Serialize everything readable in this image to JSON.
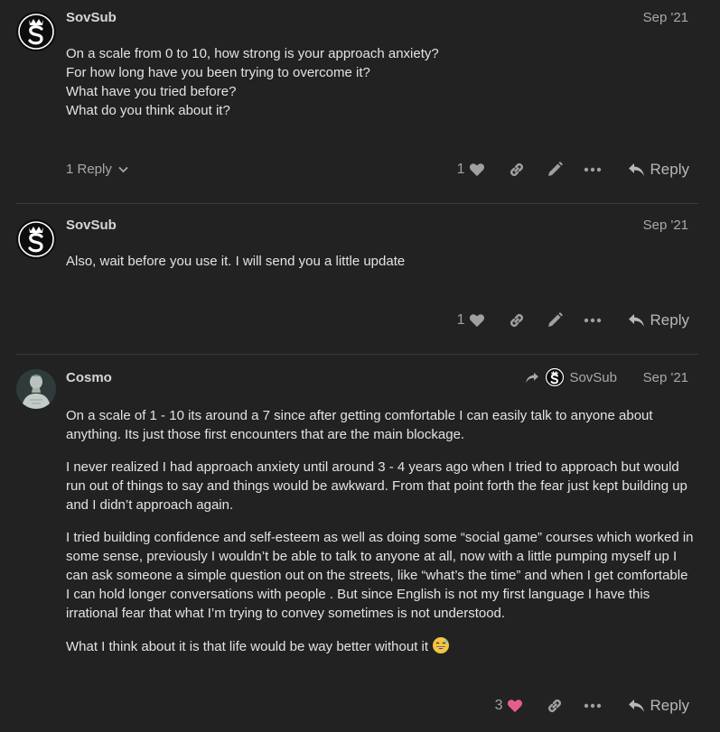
{
  "colors": {
    "background": "#222222",
    "text": "#e3e3e3",
    "muted": "#a9a9a9",
    "liked_heart": "#e45f88"
  },
  "posts": [
    {
      "username": "SovSub",
      "date": "Sep '21",
      "lines": [
        "On a scale from 0 to 10, how strong is your approach anxiety?",
        "For how long have you been trying to overcome it?",
        "What have you tried before?",
        "What do you think about it?"
      ],
      "replies_label": "1 Reply",
      "likes": "1",
      "reply_label": "Reply"
    },
    {
      "username": "SovSub",
      "date": "Sep '21",
      "lines": [
        "Also, wait before you use it. I will send you a little update"
      ],
      "likes": "1",
      "reply_label": "Reply"
    },
    {
      "username": "Cosmo",
      "date": "Sep '21",
      "reply_to_user": "SovSub",
      "paragraphs": [
        "On a scale of 1 - 10 its around a 7 since after getting comfortable I can easily talk to anyone about anything. Its just those first encounters that are the main blockage.",
        "I never realized I had approach anxiety until around 3 - 4 years ago when I tried to approach but would run out of things to say and things would be awkward. From that point forth the fear just kept building up and I didn’t approach again.",
        "I tried building confidence and self-esteem as well as doing some “social game” courses which worked in some sense, previously I wouldn’t be able to talk to anyone at all, now with a little pumping myself up I can ask someone a simple question out on the streets, like “what’s the time” and when I get comfortable I can hold longer conversations with people . But since English is not my first language I have this irrational fear that what I’m trying to convey sometimes is not understood.",
        "What I think about it is that life would be way better without it"
      ],
      "likes": "3",
      "reply_label": "Reply"
    }
  ]
}
